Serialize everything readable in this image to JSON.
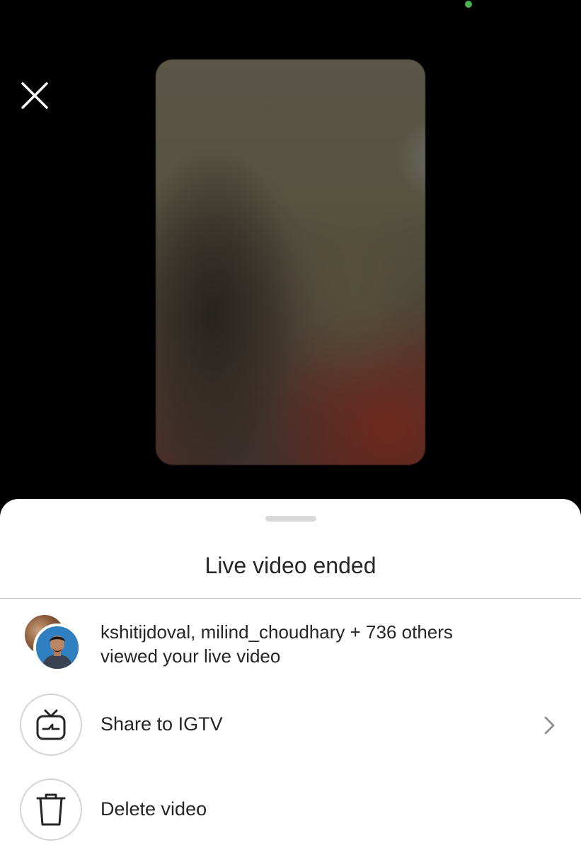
{
  "colors": {
    "background": "#000000",
    "sheet": "#ffffff",
    "status_dot": "#4caf50",
    "text_primary": "#262626",
    "divider": "#c9c9c9",
    "circle_border": "#d4d4d4"
  },
  "icons": {
    "close": "close-icon",
    "igtv": "igtv-icon",
    "delete": "trash-icon",
    "chevron": "chevron-right-icon"
  },
  "sheet": {
    "title": "Live video ended",
    "viewers": {
      "names": "kshitijdoval, milind_choudhary + 736 others",
      "subtitle": "viewed your live video"
    },
    "actions": [
      {
        "label": "Share to IGTV"
      },
      {
        "label": "Delete video"
      }
    ]
  }
}
